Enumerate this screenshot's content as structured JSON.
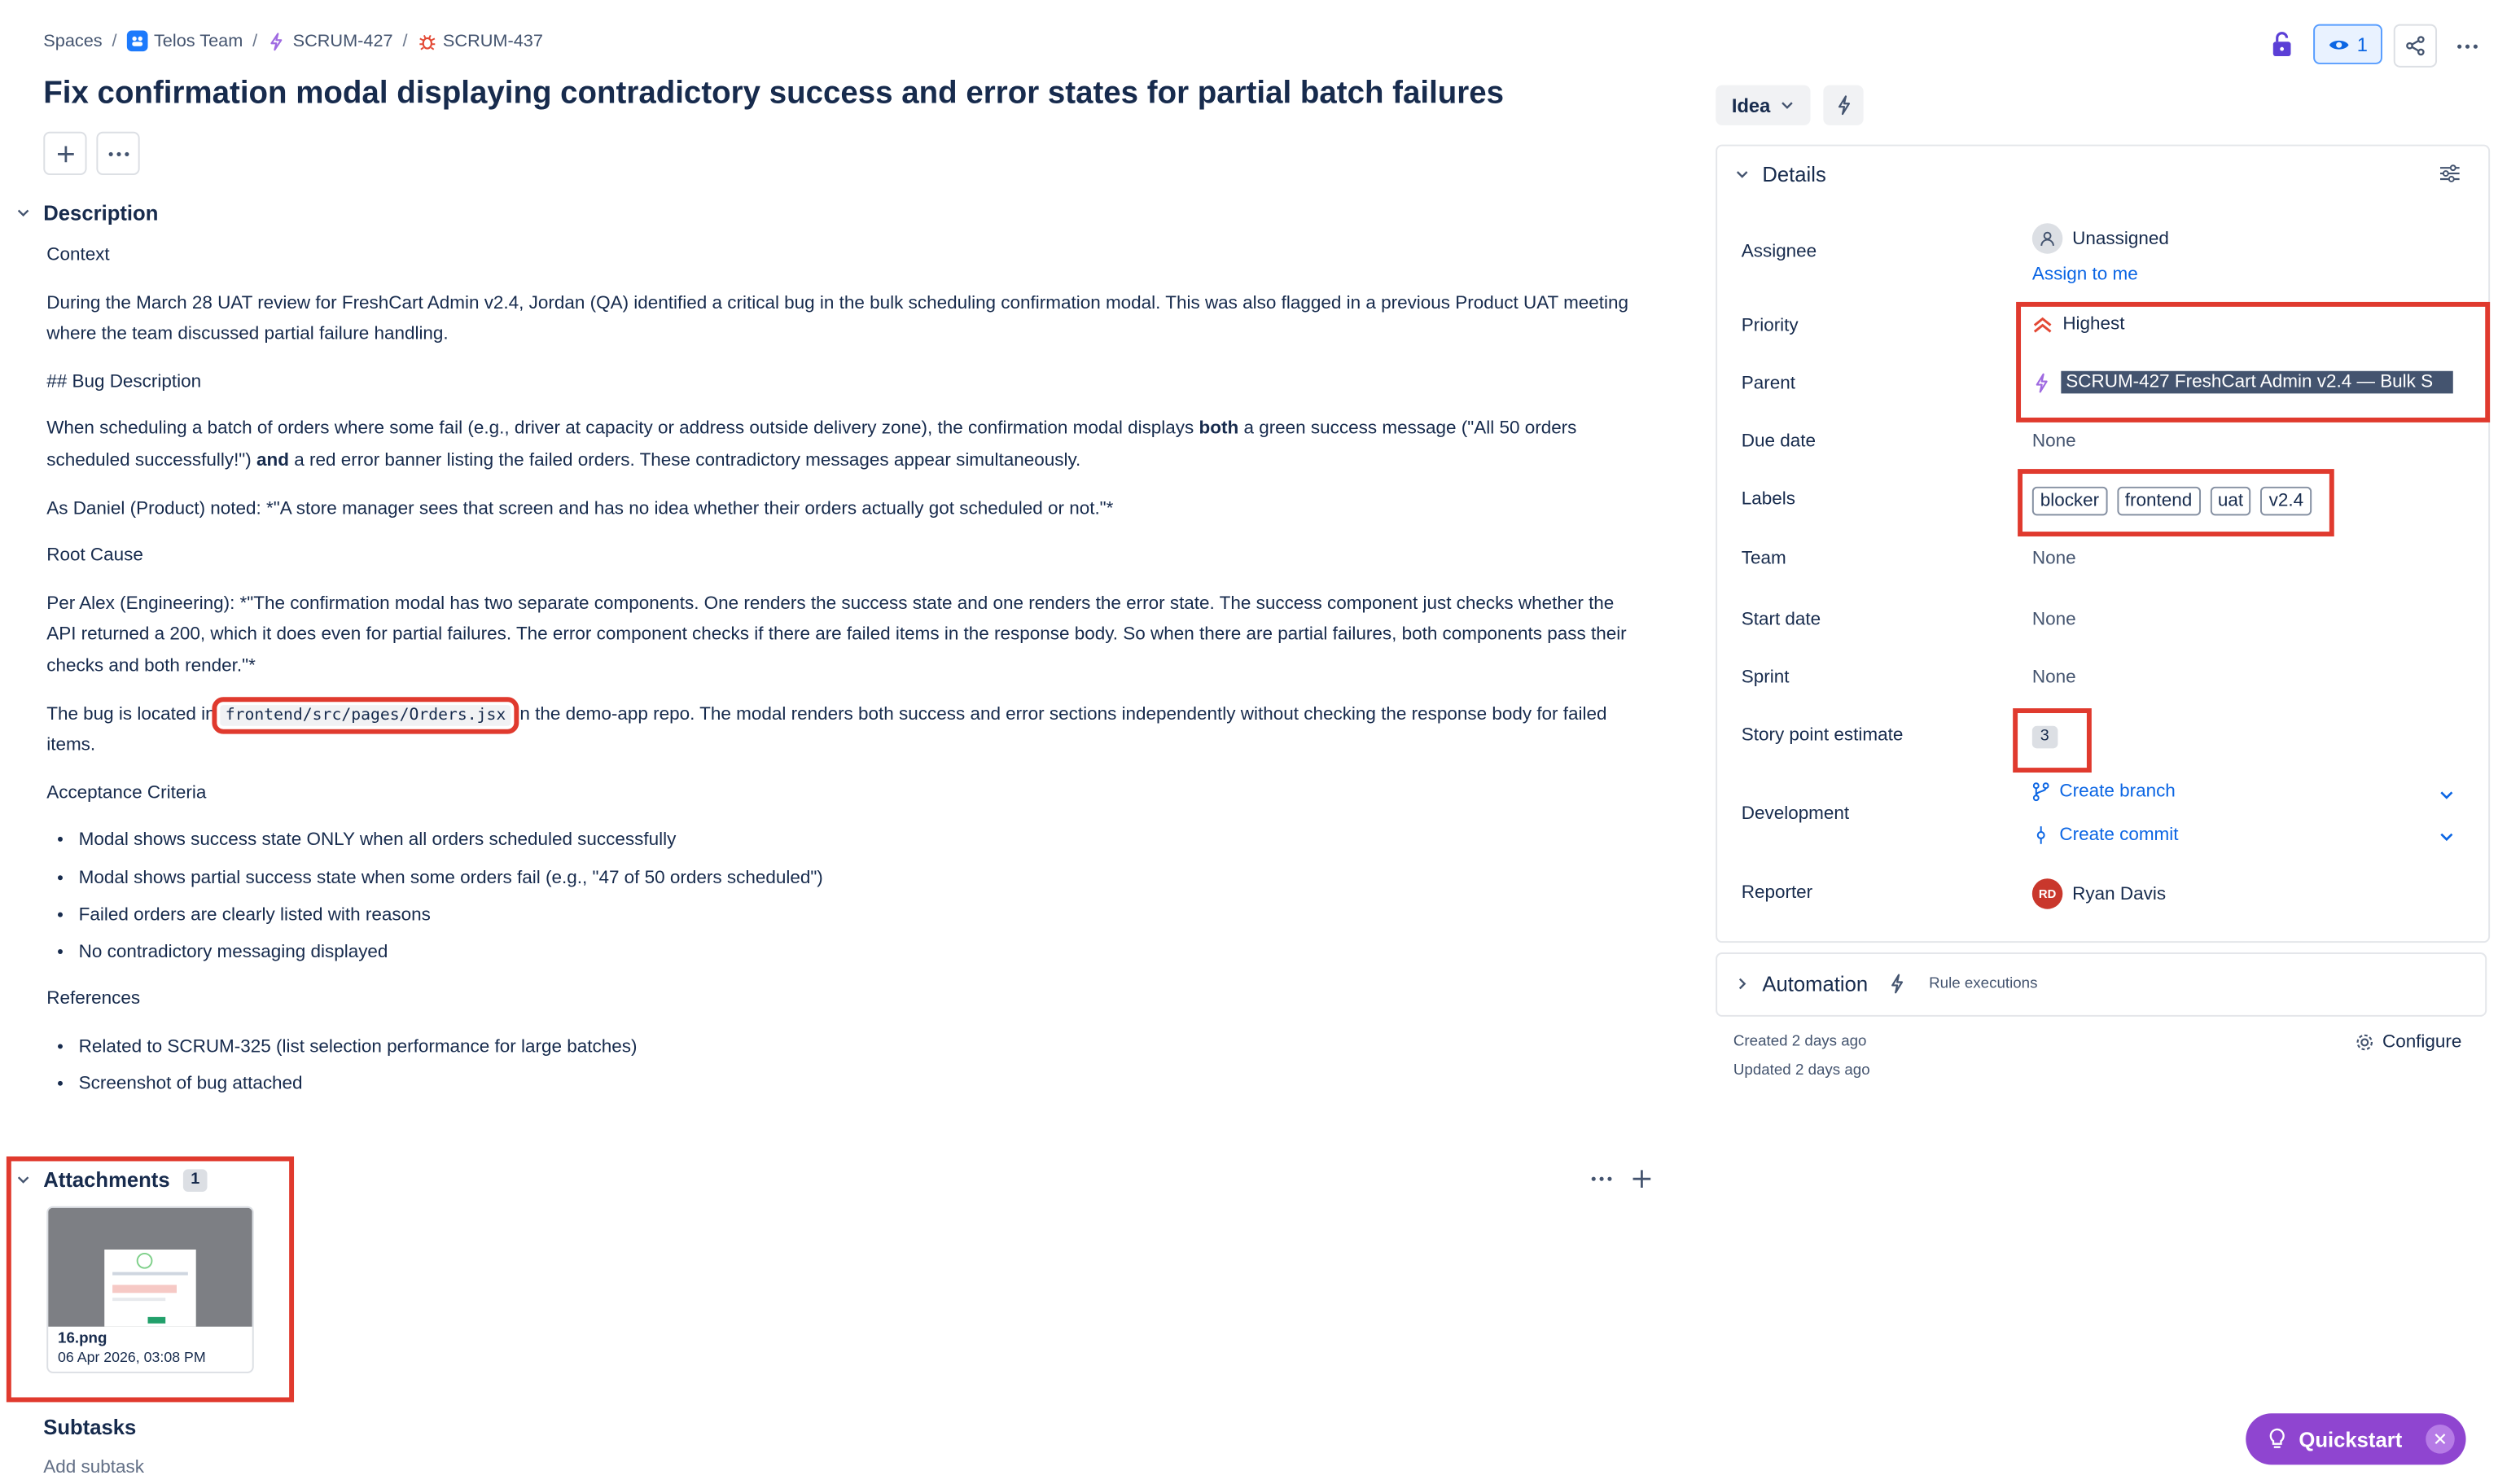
{
  "breadcrumb": {
    "spaces": "Spaces",
    "team": "Telos Team",
    "parent": "SCRUM-427",
    "issue": "SCRUM-437"
  },
  "issue": {
    "title": "Fix confirmation modal displaying contradictory success and error states for partial batch failures"
  },
  "description": {
    "heading": "Description",
    "context_heading": "Context",
    "context_text": "During the March 28 UAT review for FreshCart Admin v2.4, Jordan (QA) identified a critical bug in the bulk scheduling confirmation modal. This was also flagged in a previous Product UAT meeting where the team discussed partial failure handling.",
    "bug_heading": "## Bug Description",
    "bug_text_1": "When scheduling a batch of orders where some fail (e.g., driver at capacity or address outside delivery zone), the confirmation modal displays ",
    "bug_bold_1": "both",
    "bug_text_2": " a green success message (\"All 50 orders scheduled successfully!\") ",
    "bug_bold_2": "and",
    "bug_text_3": " a red error banner listing the failed orders. These contradictory messages appear simultaneously.",
    "daniel_quote": "As Daniel (Product) noted: *\"A store manager sees that screen and has no idea whether their orders actually got scheduled or not.\"*",
    "root_cause_heading": "Root Cause",
    "root_cause_text": "Per Alex (Engineering): *\"The confirmation modal has two separate components. One renders the success state and one renders the error state. The success component just checks whether the API returned a 200, which it does even for partial failures. The error component checks if there are failed items in the response body. So when there are partial failures, both components pass their checks and both render.\"*",
    "location_pre": "The bug is located in ",
    "location_code": "frontend/src/pages/Orders.jsx",
    "location_post": " in the demo-app repo. The modal renders both success and error sections independently without checking the response body for failed items.",
    "acceptance_heading": "Acceptance Criteria",
    "acceptance": [
      "Modal shows success state ONLY when all orders scheduled successfully",
      "Modal shows partial success state when some orders fail (e.g., \"47 of 50 orders scheduled\")",
      "Failed orders are clearly listed with reasons",
      "No contradictory messaging displayed"
    ],
    "references_heading": "References",
    "references": [
      "Related to SCRUM-325 (list selection performance for large batches)",
      "Screenshot of bug attached"
    ]
  },
  "attachments": {
    "heading": "Attachments",
    "count": "1",
    "file_name": "16.png",
    "file_date": "06 Apr 2026, 03:08 PM"
  },
  "subtasks": {
    "heading": "Subtasks",
    "add": "Add subtask"
  },
  "toolbar": {
    "watch_count": "1",
    "status": "Idea"
  },
  "details": {
    "heading": "Details",
    "assignee_label": "Assignee",
    "assignee_value": "Unassigned",
    "assign_to_me": "Assign to me",
    "priority_label": "Priority",
    "priority_value": "Highest",
    "parent_label": "Parent",
    "parent_value": "SCRUM-427 FreshCart Admin v2.4 — Bulk S",
    "due_label": "Due date",
    "due_value": "None",
    "labels_label": "Labels",
    "labels": [
      "blocker",
      "frontend",
      "uat",
      "v2.4"
    ],
    "team_label": "Team",
    "team_value": "None",
    "start_label": "Start date",
    "start_value": "None",
    "sprint_label": "Sprint",
    "sprint_value": "None",
    "story_label": "Story point estimate",
    "story_value": "3",
    "dev_label": "Development",
    "create_branch": "Create branch",
    "create_commit": "Create commit",
    "reporter_label": "Reporter",
    "reporter_initials": "RD",
    "reporter_name": "Ryan Davis"
  },
  "automation": {
    "heading": "Automation",
    "rule_executions": "Rule executions"
  },
  "meta": {
    "created": "Created 2 days ago",
    "updated": "Updated 2 days ago",
    "configure": "Configure"
  },
  "quickstart": {
    "label": "Quickstart"
  },
  "colors": {
    "accent": "#0c66e4",
    "highlight_box": "#e03a2e",
    "priority_highest": "#e34935",
    "quickstart": "#8f45d0",
    "reporter_avatar": "#c9372c"
  }
}
